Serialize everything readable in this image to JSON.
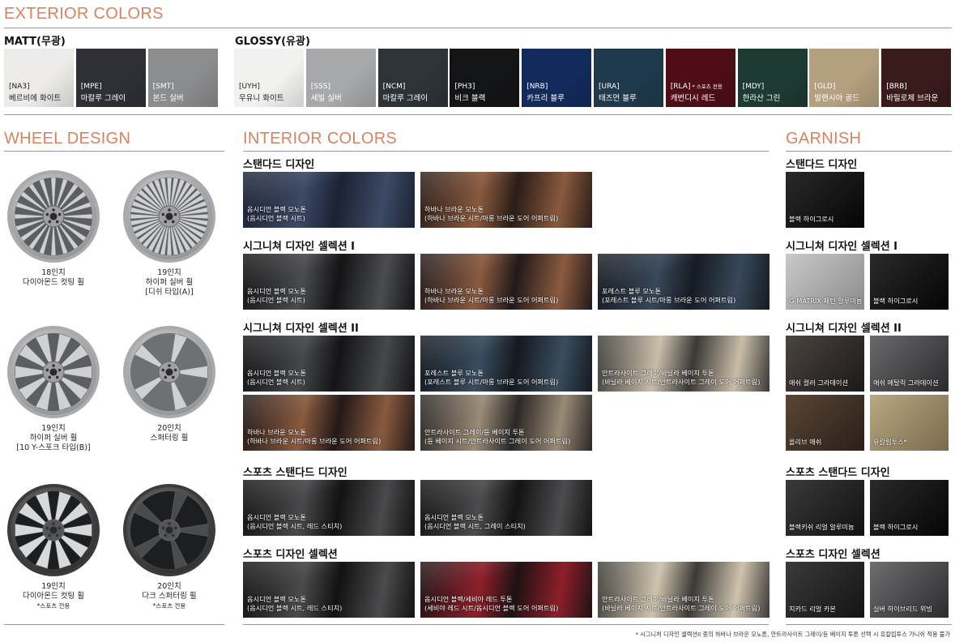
{
  "exterior": {
    "title": "EXTERIOR COLORS",
    "matt_label": "MATT(무광)",
    "glossy_label": "GLOSSY(유광)",
    "matt": [
      {
        "code": "[NA3]",
        "name": "베르비에 화이트",
        "color": "#ecebe8",
        "text_color": "#222"
      },
      {
        "code": "[MPE]",
        "name": "마칼루 그레이",
        "color": "#2d3136",
        "text_color": "#fff"
      },
      {
        "code": "[SMT]",
        "name": "본드 실버",
        "color": "#8b8c8e",
        "text_color": "#fff"
      }
    ],
    "glossy": [
      {
        "code": "[UYH]",
        "name": "우유니 화이트",
        "color": "#f1f1f0",
        "text_color": "#222",
        "note": ""
      },
      {
        "code": "[SSS]",
        "name": "세빌 실버",
        "color": "#a7a8aa",
        "text_color": "#fff",
        "note": ""
      },
      {
        "code": "[NCM]",
        "name": "마칼루 그레이",
        "color": "#2e3338",
        "text_color": "#fff",
        "note": ""
      },
      {
        "code": "[PH3]",
        "name": "비크 블랙",
        "color": "#131416",
        "text_color": "#fff",
        "note": ""
      },
      {
        "code": "[NRB]",
        "name": "카프리 블루",
        "color": "#132a5c",
        "text_color": "#fff",
        "note": ""
      },
      {
        "code": "[URA]",
        "name": "태즈먼 블루",
        "color": "#1f3a4c",
        "text_color": "#fff",
        "note": ""
      },
      {
        "code": "[RLA]",
        "name": "캐번디시 레드",
        "color": "#4f0d16",
        "text_color": "#fff",
        "note": "* 스포츠 전용"
      },
      {
        "code": "[MDY]",
        "name": "한라산 그린",
        "color": "#1e3b33",
        "text_color": "#fff",
        "note": ""
      },
      {
        "code": "[GLD]",
        "name": "발렌시아 골드",
        "color": "#b49f7e",
        "text_color": "#fff",
        "note": ""
      },
      {
        "code": "[BRB]",
        "name": "바릴로체 브라운",
        "color": "#3a1b1c",
        "text_color": "#fff",
        "note": ""
      }
    ]
  },
  "wheel": {
    "title": "WHEEL DESIGN",
    "items": [
      {
        "line1": "18인치",
        "line2": "다이아몬드 컷팅 휠",
        "line3": "",
        "note": ""
      },
      {
        "line1": "19인치",
        "line2": "하이퍼 실버 휠",
        "line3": "[디쉬 타입(A)]",
        "note": ""
      },
      {
        "line1": "19인치",
        "line2": "하이퍼 실버 휠",
        "line3": "[10 Y-스포크 타입(B)]",
        "note": ""
      },
      {
        "line1": "20인치",
        "line2": "스퍼터링 휠",
        "line3": "",
        "note": ""
      },
      {
        "line1": "19인치",
        "line2": "다이아몬드 컷팅 휠",
        "line3": "",
        "note": "*스포츠 전용"
      },
      {
        "line1": "20인치",
        "line2": "다크 스퍼터링 휠",
        "line3": "",
        "note": "*스포츠 전용"
      }
    ]
  },
  "interior": {
    "title": "INTERIOR COLORS",
    "groups": [
      {
        "title": "스탠다드 디자인",
        "tiles": [
          {
            "line1": "옵시디언 블랙 모노톤",
            "line2": "(옵시디언 블랙 시트)",
            "c1": "#3c4a66",
            "c2": "#1b2233"
          },
          {
            "line1": "하바나 브라운 모노톤",
            "line2": "(하바나 브라운 시트/마롱 브라운 도어 어퍼트림)",
            "c1": "#8a5a3e",
            "c2": "#2a1d18"
          }
        ]
      },
      {
        "title": "시그니쳐 디자인 셀렉션 I",
        "tiles": [
          {
            "line1": "옵시디언 블랙 모노톤",
            "line2": "(옵시디언 블랙 시트)",
            "c1": "#4a4c50",
            "c2": "#141416"
          },
          {
            "line1": "하바나 브라운 모노톤",
            "line2": "(하바나 브라운 시트/마롱 브라운 도어 어퍼트림)",
            "c1": "#8b5b3f",
            "c2": "#22191a"
          },
          {
            "line1": "포레스트 블루 모노톤",
            "line2": "(포레스트 블루 시트/마롱 브라운 도어 어퍼트림)",
            "c1": "#37485a",
            "c2": "#161b22"
          }
        ]
      },
      {
        "title": "시그니쳐 디자인 셀렉션 II",
        "tiles": [
          {
            "line1": "옵시디언 블랙 모노톤",
            "line2": "(옵시디언 블랙 시트)",
            "c1": "#46484c",
            "c2": "#141416"
          },
          {
            "line1": "포레스트 블루 모노톤",
            "line2": "(포레스트 블루 시트/마롱 브라운 도어 어퍼트림)",
            "c1": "#3a4d5f",
            "c2": "#14191f"
          },
          {
            "line1": "안트라사이트 그레이/바닐라 베이지 투톤",
            "line2": "(바닐라 베이지 시트/안트라사이트 그레이 도어 어퍼트림)",
            "c1": "#c9bda8",
            "c2": "#3a3936"
          },
          {
            "line1": "하바나 브라운 모노톤",
            "line2": "(하바나 브라운 시트/마롱 브라운 도어 어퍼트림)",
            "c1": "#8a5a3e",
            "c2": "#221918"
          },
          {
            "line1": "안트라사이트 그레이/듄 베이지 투톤",
            "line2": "(듄 베이지 시트/안트라사이트 그레이 도어 어퍼트림)",
            "c1": "#9a8a76",
            "c2": "#2a2826"
          }
        ]
      },
      {
        "title": "스포츠 스탠다드 디자인",
        "tiles": [
          {
            "line1": "옵시디언 블랙 모노톤",
            "line2": "(옵시디언 블랙 시트, 레드 스티치)",
            "c1": "#4a4a4c",
            "c2": "#121213"
          },
          {
            "line1": "옵시디언 블랙 모노톤",
            "line2": "(옵시디언 블랙 시트, 그레이 스티치)",
            "c1": "#4c4c4e",
            "c2": "#131314"
          }
        ]
      },
      {
        "title": "스포츠 디자인 셀렉션",
        "tiles": [
          {
            "line1": "옵시디언 블랙 모노톤",
            "line2": "(옵시디언 블랙 시트, 레드 스티치)",
            "c1": "#4b4b4d",
            "c2": "#121213"
          },
          {
            "line1": "옵시디언 블랙/세비야 레드 투톤",
            "line2": "(세비야 레드 시트/옵시디언 블랙 도어 어퍼트림)",
            "c1": "#8e1f2a",
            "c2": "#1e1214"
          },
          {
            "line1": "안트라사이트 그레이/바닐라 베이지 투톤",
            "line2": "(바닐라 베이지 시트/안트라사이트 그레이 도어 어퍼트림)",
            "c1": "#cfc3ae",
            "c2": "#3b3a37"
          }
        ]
      }
    ]
  },
  "garnish": {
    "title": "GARNISH",
    "groups": [
      {
        "title": "스탠다드 디자인",
        "tiles": [
          {
            "label": "블랙 하이그로시",
            "c1": "#2a2a2c",
            "c2": "#050506"
          }
        ]
      },
      {
        "title": "시그니쳐 디자인 셀렉션 I",
        "tiles": [
          {
            "label": "G-MATRIX 패턴 알루미늄",
            "c1": "#c9c9c9",
            "c2": "#8c8c8c"
          },
          {
            "label": "블랙 하이그로시",
            "c1": "#2a2a2c",
            "c2": "#050506"
          }
        ]
      },
      {
        "title": "시그니쳐 디자인 셀렉션 II",
        "tiles": [
          {
            "label": "애쉬 컬러 그라데이션",
            "c1": "#4a4441",
            "c2": "#1c1917"
          },
          {
            "label": "애쉬 메탈릭 그라데이션",
            "c1": "#6a6a6c",
            "c2": "#2b2b2d"
          },
          {
            "label": "올리브 애쉬",
            "c1": "#5a4636",
            "c2": "#2a1f18"
          },
          {
            "label": "유칼립투스*",
            "c1": "#b8a883",
            "c2": "#7b6a4c"
          }
        ]
      },
      {
        "title": "스포츠 스탠다드 디자인",
        "tiles": [
          {
            "label": "블랙키쉬 리얼 알루미늄",
            "c1": "#3a3a3b",
            "c2": "#111112"
          },
          {
            "label": "블랙 하이그로시",
            "c1": "#2a2a2c",
            "c2": "#050506"
          }
        ]
      },
      {
        "title": "스포츠 디자인 셀렉션",
        "tiles": [
          {
            "label": "지카드 리얼 카본",
            "c1": "#3a3a3c",
            "c2": "#141415"
          },
          {
            "label": "실버 하이브리드 위빙",
            "c1": "#6e6e70",
            "c2": "#2c2c2e"
          }
        ]
      }
    ]
  },
  "footnote": "* 시그니처 디자인 셀렉션II 중의 하바나 브라운 모노톤, 안트라사이트 그레이/듄 베이지 투톤 선택 시 유칼립투스 가니쉬 적용 불가"
}
